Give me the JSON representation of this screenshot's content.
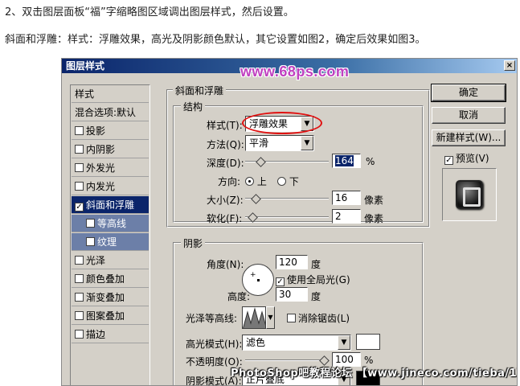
{
  "intro": {
    "line1": "2、双击图层面板“福”字缩略图区域调出图层样式，然后设置。",
    "line2": "斜面和浮雕：样式：浮雕效果，高光及阴影颜色默认，其它设置如图2，确定后效果如图3。"
  },
  "dialog": {
    "title": "图层样式",
    "close_label": "×",
    "watermark_top": "www.68ps.com",
    "watermark_bottom": "PhotoShop吧教程论坛 【www.jineco.com/tieba/1783】"
  },
  "left_list": {
    "header": "样式",
    "blend": "混合选项:默认",
    "items": [
      {
        "label": "投影",
        "checked": false
      },
      {
        "label": "内阴影",
        "checked": false
      },
      {
        "label": "外发光",
        "checked": false
      },
      {
        "label": "内发光",
        "checked": false
      },
      {
        "label": "斜面和浮雕",
        "checked": true
      },
      {
        "label": "等高线",
        "checked": false
      },
      {
        "label": "纹理",
        "checked": false
      },
      {
        "label": "光泽",
        "checked": false
      },
      {
        "label": "颜色叠加",
        "checked": false
      },
      {
        "label": "渐变叠加",
        "checked": false
      },
      {
        "label": "图案叠加",
        "checked": false
      },
      {
        "label": "描边",
        "checked": false
      }
    ],
    "check_mark": "✓"
  },
  "bevel": {
    "title": "斜面和浮雕",
    "structure_title": "结构",
    "style_label": "样式(T):",
    "style_value": "浮雕效果",
    "technique_label": "方法(Q):",
    "technique_value": "平滑",
    "depth_label": "深度(D):",
    "depth_value": "164",
    "depth_unit": "%",
    "direction_label": "方向:",
    "direction_up": "上",
    "direction_down": "下",
    "size_label": "大小(Z):",
    "size_value": "16",
    "size_unit": "像素",
    "soften_label": "软化(F):",
    "soften_value": "2",
    "soften_unit": "像素"
  },
  "shading": {
    "title": "阴影",
    "angle_label": "角度(N):",
    "angle_value": "120",
    "angle_unit": "度",
    "global_light_label": "使用全局光(G)",
    "global_light_checked": true,
    "altitude_label": "高度:",
    "altitude_value": "30",
    "altitude_unit": "度",
    "gloss_label": "光泽等高线:",
    "antialias_label": "消除锯齿(L)",
    "antialias_checked": false,
    "highlight_mode_label": "高光模式(H):",
    "highlight_mode_value": "滤色",
    "highlight_opacity_label": "不透明度(O):",
    "highlight_opacity_value": "100",
    "highlight_opacity_unit": "%",
    "shadow_mode_label": "阴影模式(A):",
    "shadow_mode_value": "正片叠底",
    "highlight_color": "#ffffff",
    "shadow_color": "#000000"
  },
  "buttons": {
    "ok": "确定",
    "cancel": "取消",
    "new_style": "新建样式(W)...",
    "preview_label": "预览(V)",
    "preview_checked": true
  },
  "levels": {
    "depth_fraction": 0.16,
    "size_fraction": 0.1,
    "soften_fraction": 0.05,
    "highlight_opacity_fraction": 1.0
  }
}
